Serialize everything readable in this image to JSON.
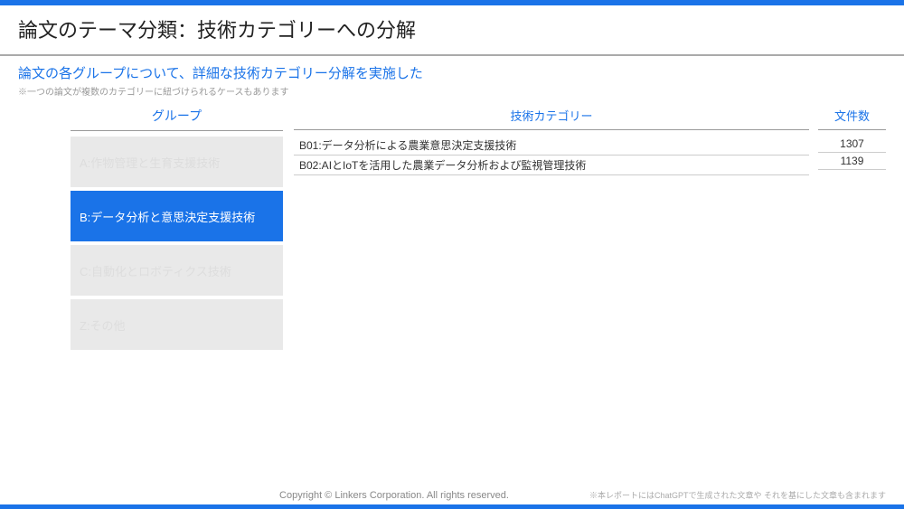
{
  "page_title": "論文のテーマ分類：技術カテゴリーへの分解",
  "section_title": "論文の各グループについて、詳細な技術カテゴリー分解を実施した",
  "note": "※一つの論文が複数のカテゴリーに紐づけられるケースもあります",
  "sidebar": {
    "header": "グループ",
    "items": [
      {
        "label": "A:作物管理と生育支援技術",
        "active": false
      },
      {
        "label": "B:データ分析と意思決定支援技術",
        "active": true
      },
      {
        "label": "C:自動化とロボティクス技術",
        "active": false
      },
      {
        "label": "Z:その他",
        "active": false
      }
    ]
  },
  "category_header": "技術カテゴリー",
  "count_header": "文件数",
  "rows": [
    {
      "category": "B01:データ分析による農業意思決定支援技術",
      "count": "1307"
    },
    {
      "category": "B02:AIとIoTを活用した農業データ分析および監視管理技術",
      "count": "1139"
    }
  ],
  "copyright": "Copyright © Linkers Corporation. All rights reserved.",
  "disclaimer": "※本レポートにはChatGPTで生成された文章や それを基にした文章も含まれます"
}
